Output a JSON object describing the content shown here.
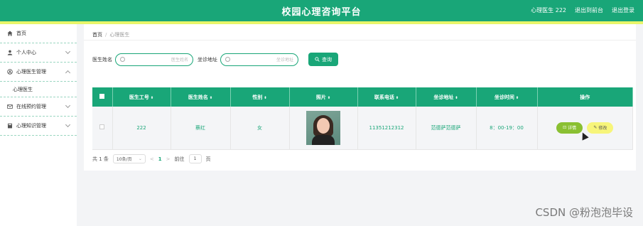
{
  "header": {
    "title": "校园心理咨询平台",
    "user_label": "心理医生 222",
    "back_to_admin": "退出到前台",
    "logout": "退出登录"
  },
  "sidebar": {
    "items": [
      {
        "label": "首页",
        "icon": "home-icon"
      },
      {
        "label": "个人中心",
        "icon": "user-icon"
      },
      {
        "label": "心理医生管理",
        "icon": "doctor-icon",
        "submenu": [
          "心理医生"
        ]
      },
      {
        "label": "在线预约管理",
        "icon": "mail-icon"
      },
      {
        "label": "心理知识管理",
        "icon": "book-icon"
      }
    ]
  },
  "breadcrumb": {
    "home": "首页",
    "sep": "/",
    "current": "心理医生"
  },
  "search": {
    "name_label": "医生姓名",
    "name_placeholder": "医生姓名",
    "addr_label": "坐诊地址",
    "addr_placeholder": "坐诊地址",
    "button": "查询"
  },
  "table": {
    "headers": [
      "医生工号",
      "医生姓名",
      "性别",
      "照片",
      "联系电话",
      "坐诊地址",
      "坐诊时间",
      "操作"
    ],
    "rows": [
      {
        "id": "222",
        "name": "蔡红",
        "gender": "女",
        "phone": "11351212312",
        "address": "范德萨范德萨",
        "time": "8：00-19：00",
        "detail": "详情",
        "edit": "修改"
      }
    ]
  },
  "pager": {
    "total": "共 1 条",
    "page_size": "10条/页",
    "prev": "<",
    "current_page": "1",
    "next": ">",
    "goto_label": "前往",
    "goto_value": "1",
    "page_unit": "页"
  },
  "watermark": "CSDN @粉泡泡毕设",
  "colors": {
    "primary": "#19a678",
    "accent_bar": "#e8f56a",
    "detail_button": "#8ac032",
    "edit_button": "#f7f57a"
  }
}
